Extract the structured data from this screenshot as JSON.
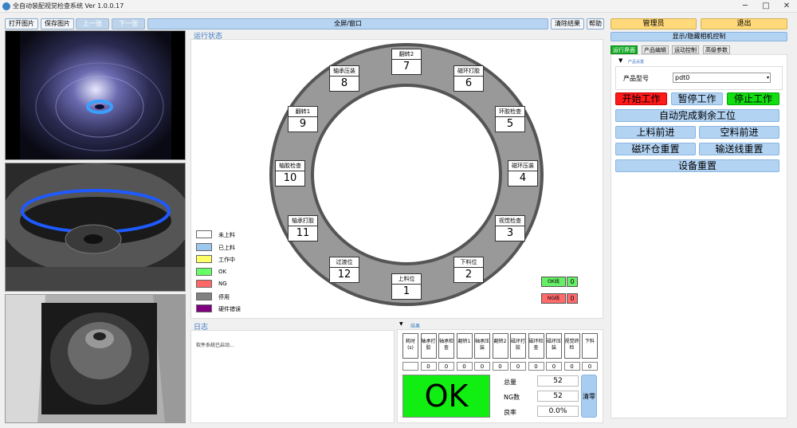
{
  "window": {
    "title": "全自动装配视觉检查系统 Ver 1.0.0.17",
    "minimize": "─",
    "maximize": "□",
    "close": "✕"
  },
  "toolbar": {
    "open_image": "打开图片",
    "save_image": "保存图片",
    "prev": "上一张",
    "next": "下一张",
    "fullscreen": "全屏/窗口",
    "clear_results": "清除结果",
    "help": "帮助"
  },
  "status_panel": {
    "title": "运行状态"
  },
  "stations": [
    {
      "label": "上料位",
      "num": "1"
    },
    {
      "label": "下料位",
      "num": "2"
    },
    {
      "label": "视觉检查",
      "num": "3"
    },
    {
      "label": "磁环压装",
      "num": "4"
    },
    {
      "label": "环胶检查",
      "num": "5"
    },
    {
      "label": "磁环打胶",
      "num": "6"
    },
    {
      "label": "翻转2",
      "num": "7"
    },
    {
      "label": "轴承压装",
      "num": "8"
    },
    {
      "label": "翻转1",
      "num": "9"
    },
    {
      "label": "轴胶检查",
      "num": "10"
    },
    {
      "label": "轴承打胶",
      "num": "11"
    },
    {
      "label": "过渡位",
      "num": "12"
    }
  ],
  "legend": [
    {
      "label": "未上料",
      "color": "#ffffff"
    },
    {
      "label": "已上料",
      "color": "#9cc8f0"
    },
    {
      "label": "工作中",
      "color": "#ffff66"
    },
    {
      "label": "OK",
      "color": "#66ff66"
    },
    {
      "label": "NG",
      "color": "#ff6666"
    },
    {
      "label": "停用",
      "color": "#808080"
    },
    {
      "label": "硬件错误",
      "color": "#800080"
    }
  ],
  "lines": {
    "ok_label": "OK线",
    "ok_value": "0",
    "ng_label": "NG线",
    "ng_value": "0"
  },
  "log": {
    "title": "日志",
    "text": "软件系统已启动..."
  },
  "results": {
    "title": "结果",
    "columns": [
      "耗时(s)",
      "轴承打胶",
      "轴承检查",
      "翻转1",
      "轴承压装",
      "翻转2",
      "磁环打胶",
      "磁环检查",
      "磁环压装",
      "视觉终检",
      "下料"
    ],
    "values": [
      "",
      "0",
      "0",
      "0",
      "0",
      "0",
      "0",
      "0",
      "0",
      "0",
      "0"
    ],
    "big_status": "OK",
    "total_label": "总量",
    "total_value": "52",
    "ng_label": "NG数",
    "ng_value": "52",
    "yield_label": "良率",
    "yield_value": "0.0%",
    "clear_label": "清零"
  },
  "right": {
    "admin": "管理员",
    "exit": "退出",
    "toggle_camera": "显示/隐藏相机控制",
    "tabs": [
      "运行界面",
      "产品编辑",
      "运动控制",
      "高级参数"
    ],
    "product_settings": "产品设置",
    "product_type_label": "产品型号",
    "product_type_value": "pdt0",
    "start": "开始工作",
    "pause": "暂停工作",
    "stop": "停止工作",
    "finish_remaining": "自动完成剩余工位",
    "load_forward": "上料前进",
    "empty_forward": "空料前进",
    "magnet_reset": "磁环仓重置",
    "conveyor_reset": "输送线重置",
    "device_reset": "设备重置"
  },
  "colors": {
    "ok": "#11ee11",
    "start": "#ff1a1a",
    "stop": "#11dd11",
    "accent": "#3b78c4"
  }
}
